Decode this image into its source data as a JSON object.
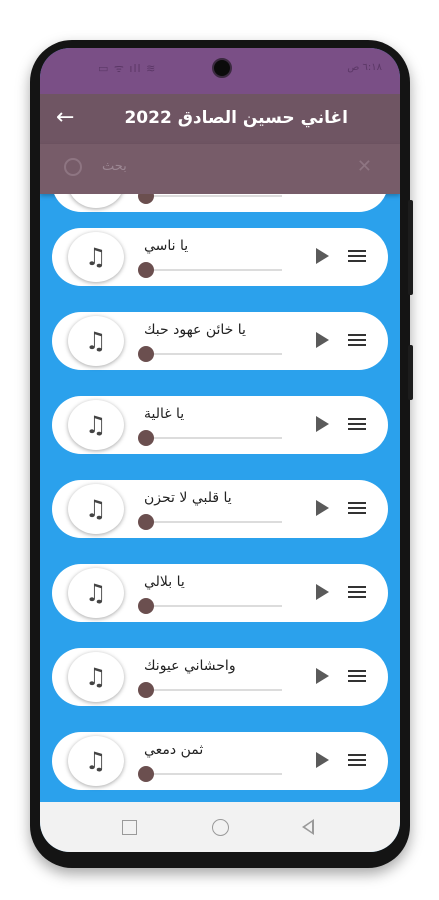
{
  "status": {
    "left": "▭ ᯤ ıll ≋",
    "right": "٦:١٨ ص"
  },
  "header": {
    "back_icon": "arrow-left-icon",
    "title": "اغاني حسين الصادق 2022"
  },
  "search": {
    "placeholder": "بحث",
    "icon": "search-icon",
    "close_icon": "close-icon"
  },
  "songs": [
    {
      "title": "",
      "progress": 0
    },
    {
      "title": "يا ناسي",
      "progress": 0
    },
    {
      "title": "يا خائن عهود حبك",
      "progress": 0
    },
    {
      "title": "يا غالية",
      "progress": 0
    },
    {
      "title": "يا قلبي لا تحزن",
      "progress": 0
    },
    {
      "title": "يا بلالي",
      "progress": 0
    },
    {
      "title": "واحشاني عيونك",
      "progress": 0
    },
    {
      "title": "ثمن دمعي",
      "progress": 0
    }
  ],
  "icons": {
    "song_icon": "music-note-icon",
    "play_icon": "play-icon",
    "menu_icon": "menu-icon"
  },
  "nav": [
    "recents-button",
    "home-button",
    "back-button"
  ],
  "colors": {
    "background": "#2ba1ec",
    "appbar": "#6f5563",
    "statusbar": "#7a4f86",
    "thumb": "#6b4f4f"
  }
}
